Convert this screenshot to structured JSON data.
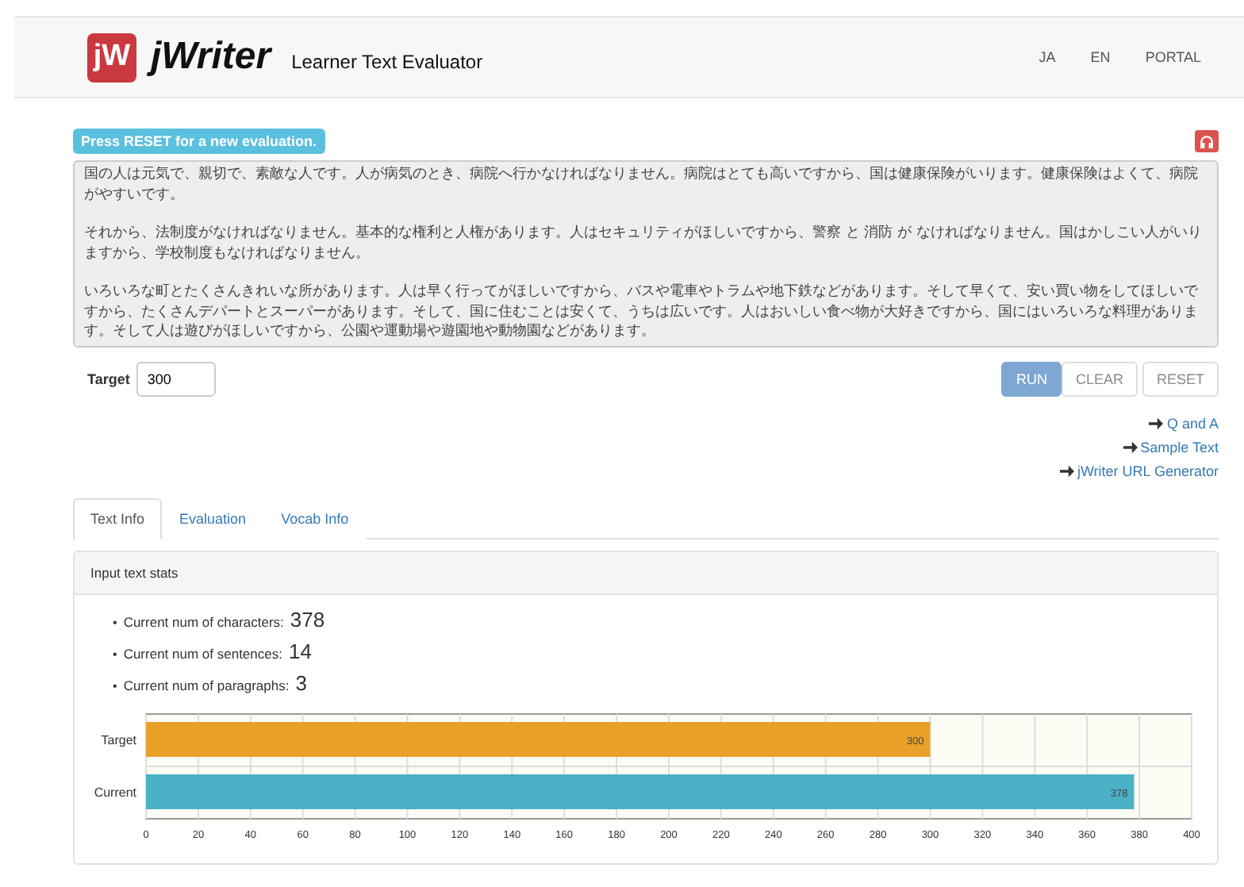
{
  "header": {
    "logo_mark": "jW",
    "brand": "jWriter",
    "subtitle": "Learner Text Evaluator",
    "nav": [
      "JA",
      "EN",
      "PORTAL"
    ]
  },
  "notice": "Press RESET for a new evaluation.",
  "text_input": {
    "paragraphs": [
      "国の人は元気で、親切で、素敵な人です。人が病気のとき、病院へ行かなければなりません。病院はとても高いですから、国は健康保険がいります。健康保険はよくて、病院がやすいです。",
      "それから、法制度がなければなりません。基本的な権利と人権があります。人はセキュリティがほしいですから、警察 と 消防 が なければなりません。国はかしこい人がいりますから、学校制度もなければなりません。",
      "いろいろな町とたくさんきれいな所があります。人は早く行ってがほしいですから、バスや電車やトラムや地下鉄などがあります。そして早くて、安い買い物をしてほしいですから、たくさんデパートとスーパーがあります。そして、国に住むことは安くて、うちは広いです。人はおいしい食べ物が大好きですから、国にはいろいろな料理があります。そして人は遊びがほしいですから、公園や運動場や遊園地や動物園などがあります。"
    ]
  },
  "target": {
    "label": "Target",
    "value": "300"
  },
  "buttons": [
    {
      "label": "RUN",
      "selected": true
    },
    {
      "label": "CLEAR",
      "selected": false
    },
    {
      "label": "RESET",
      "selected": false
    }
  ],
  "links": [
    "Q and A",
    "Sample Text",
    "jWriter URL Generator"
  ],
  "tabs": [
    {
      "label": "Text Info",
      "selected": true
    },
    {
      "label": "Evaluation",
      "selected": false
    },
    {
      "label": "Vocab Info",
      "selected": false
    }
  ],
  "panel": {
    "title": "Input text stats",
    "stats": [
      {
        "marker": "•",
        "label": "Current num of characters:",
        "value": "378"
      },
      {
        "marker": "•",
        "label": "Current num of sentences:",
        "value": "14"
      },
      {
        "marker": "•",
        "label": "Current num of paragraphs:",
        "value": "3"
      }
    ],
    "chart_data": {
      "type": "bar",
      "orientation": "horizontal",
      "stacked": true,
      "grid": true,
      "series": [
        {
          "name": "Target",
          "color": "#e9a128",
          "values": [
            300,
            null
          ]
        },
        {
          "name": "Current",
          "color": "#4ab1c6",
          "values": [
            null,
            378
          ]
        }
      ],
      "xlim": [
        0,
        400
      ],
      "xticks": [
        0,
        20,
        40,
        60,
        80,
        100,
        120,
        140,
        160,
        180,
        200,
        220,
        240,
        260,
        280,
        300,
        320,
        340,
        360,
        380,
        400
      ],
      "data_labels": true
    }
  }
}
